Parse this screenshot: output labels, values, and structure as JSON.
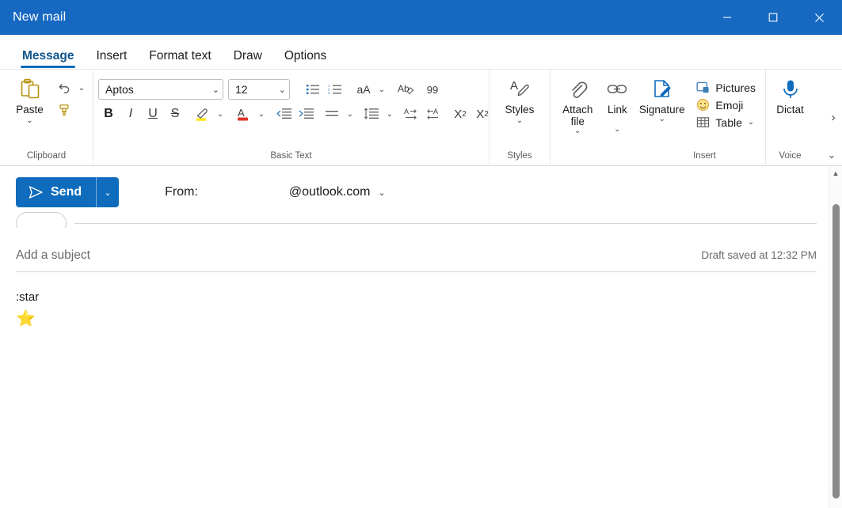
{
  "window": {
    "title": "New mail",
    "titlebar_color": "#1668c1",
    "controls": [
      {
        "name": "minimize",
        "glyph": "minimize-icon"
      },
      {
        "name": "maximize",
        "glyph": "maximize-icon"
      },
      {
        "name": "close",
        "glyph": "close-icon"
      }
    ]
  },
  "tabs": [
    {
      "label": "Message",
      "active": true
    },
    {
      "label": "Insert",
      "active": false
    },
    {
      "label": "Format text",
      "active": false
    },
    {
      "label": "Draw",
      "active": false
    },
    {
      "label": "Options",
      "active": false
    }
  ],
  "ribbon": {
    "accent": "#0f6cbd",
    "groups": {
      "clipboard": {
        "label": "Clipboard",
        "paste_label": "Paste",
        "paste_chevron": "⌄",
        "undo_chevron": "⌄"
      },
      "basic_text": {
        "label": "Basic Text",
        "font_family": "Aptos",
        "font_size": "12",
        "combo_chevron": "⌄",
        "quote_label": "99",
        "case_label": "aA",
        "clear_format_label": "Ab",
        "subscript_label": "X",
        "subscript_sub": "2",
        "superscript_label": "X",
        "superscript_sup": "2",
        "highlight_color": "#ffe600",
        "font_color": "#e0342c",
        "bold_label": "B",
        "italic_label": "I",
        "underline_label": "U",
        "strike_label": "S"
      },
      "styles": {
        "label": "Styles",
        "button_label": "Styles",
        "chevron": "⌄"
      },
      "insert": {
        "label": "Insert",
        "attach_label": "Attach file",
        "attach_chevron": "⌄",
        "link_label": "Link",
        "link_chevron": "⌄",
        "signature_label": "Signature",
        "signature_chevron": "⌄",
        "pictures_label": "Pictures",
        "emoji_label": "Emoji",
        "table_label": "Table",
        "table_chevron": "⌄"
      },
      "voice": {
        "label": "Voice",
        "dictate_label": "Dictat"
      }
    },
    "overflow_chevron": "›",
    "collapse_chevron": "⌄"
  },
  "compose": {
    "send_label": "Send",
    "send_dropdown_chevron": "⌄",
    "from_label": "From:",
    "from_value": "@outlook.com",
    "from_chevron": "⌄",
    "subject_placeholder": "Add a subject",
    "subject_value": "",
    "draft_status": "Draft saved at 12:32 PM",
    "body_line_1": ":star",
    "body_line_2": "⭐"
  },
  "scrollbar": {
    "up_arrow": "▲",
    "thumb_color": "#8a8a8a"
  }
}
